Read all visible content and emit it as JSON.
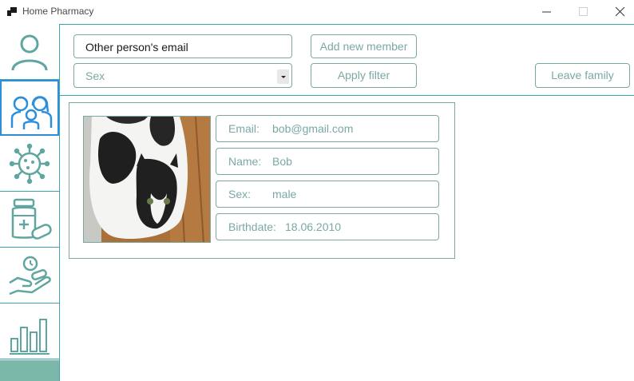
{
  "window": {
    "title": "Home Pharmacy",
    "controls": [
      "minimize",
      "maximize",
      "close"
    ]
  },
  "sidebar": {
    "items": [
      {
        "icon": "user-icon",
        "active": false
      },
      {
        "icon": "family-icon",
        "active": true
      },
      {
        "icon": "virus-icon",
        "active": false
      },
      {
        "icon": "medicine-icon",
        "active": false
      },
      {
        "icon": "hand-pills-icon",
        "active": false
      },
      {
        "icon": "bar-chart-icon",
        "active": false
      }
    ]
  },
  "toolbar": {
    "email_value": "Other person's email",
    "add_member_label": "Add new member",
    "sex_value": "Sex",
    "apply_filter_label": "Apply filter",
    "leave_family_label": "Leave family"
  },
  "member": {
    "email_label": "Email:",
    "email": "bob@gmail.com",
    "name_label": "Name:",
    "name": "Bob",
    "sex_label": "Sex:",
    "sex": "male",
    "birthdate_label": "Birthdate:",
    "birthdate": "18.06.2010"
  },
  "colors": {
    "accent": "#7aa9a4",
    "border": "#3aa8a8",
    "active_border": "#2d8fd9",
    "sidebar_bottom": "#7bb8aa"
  }
}
